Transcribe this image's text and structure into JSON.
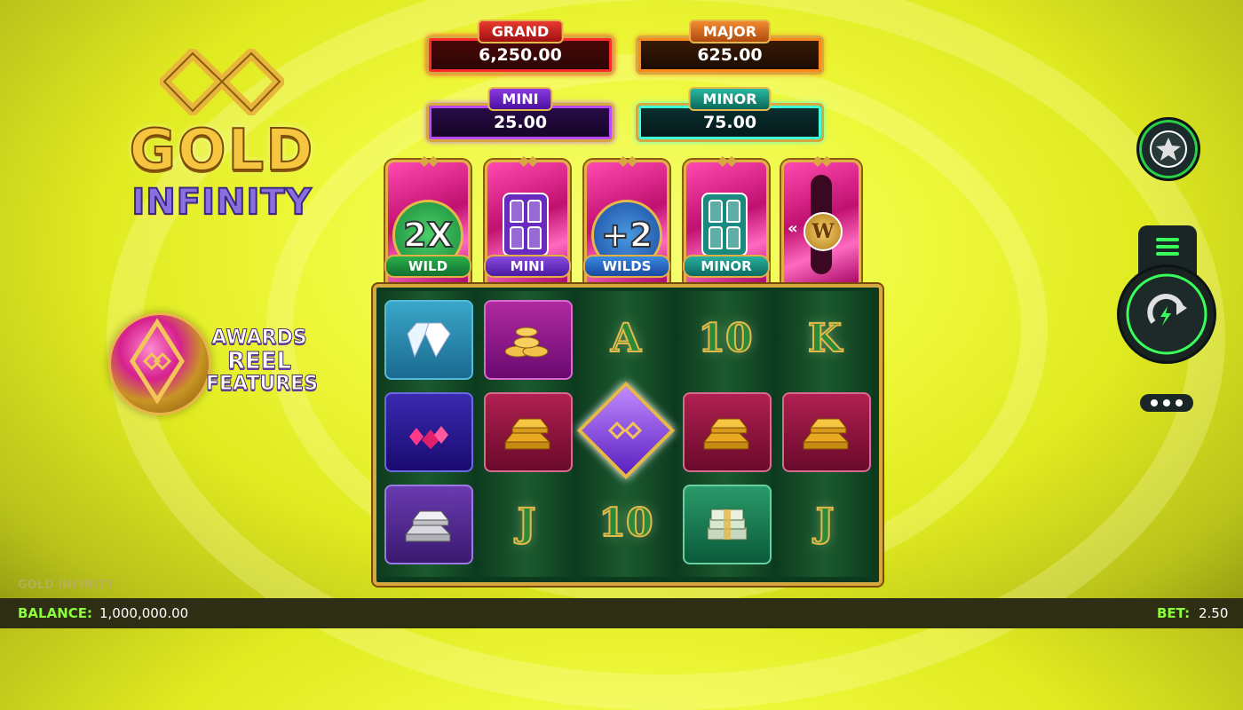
{
  "game": {
    "logo_line1": "GOLD",
    "logo_line2": "INFINITY",
    "awards_lines": [
      "AWARDS",
      "REEL",
      "FEATURES"
    ],
    "brand_footer": "GOLD INFINITY"
  },
  "jackpots": {
    "grand": {
      "label": "GRAND",
      "value": "6,250.00"
    },
    "major": {
      "label": "MAJOR",
      "value": "625.00"
    },
    "mini": {
      "label": "MINI",
      "value": "25.00"
    },
    "minor": {
      "label": "MINOR",
      "value": "75.00"
    }
  },
  "feature_reels": [
    {
      "badge": "2X",
      "label": "WILD"
    },
    {
      "badge": "",
      "label": "MINI"
    },
    {
      "badge": "+2",
      "label": "WILDS"
    },
    {
      "badge": "",
      "label": "MINOR"
    },
    {
      "badge": "W",
      "label": ""
    }
  ],
  "reels": {
    "row1": [
      "diamond-symbol",
      "coins-symbol",
      "A",
      "10",
      "K"
    ],
    "row2": [
      "ruby-symbol",
      "gold-bar-symbol",
      "wild-infinity-symbol",
      "gold-bar-symbol",
      "gold-bar-symbol"
    ],
    "row3": [
      "silver-bar-symbol",
      "J",
      "10",
      "cash-stack-symbol",
      "J"
    ],
    "letters": {
      "r1c3": "A",
      "r1c4": "10",
      "r1c5": "K",
      "r3c2": "J",
      "r3c3": "10",
      "r3c5": "J"
    }
  },
  "controls": {
    "favorite_icon": "star-icon",
    "menu_icon": "hamburger-menu-icon",
    "spin_icon": "spin-arrow-icon",
    "more_icon": "more-dots-icon"
  },
  "status_bar": {
    "balance_label": "BALANCE:",
    "balance_value": "1,000,000.00",
    "bet_label": "BET:",
    "bet_value": "2.50"
  },
  "colors": {
    "accent_green": "#8cff3a",
    "gold_border": "#d8a840",
    "reel_bg": "#0c3a1e"
  }
}
